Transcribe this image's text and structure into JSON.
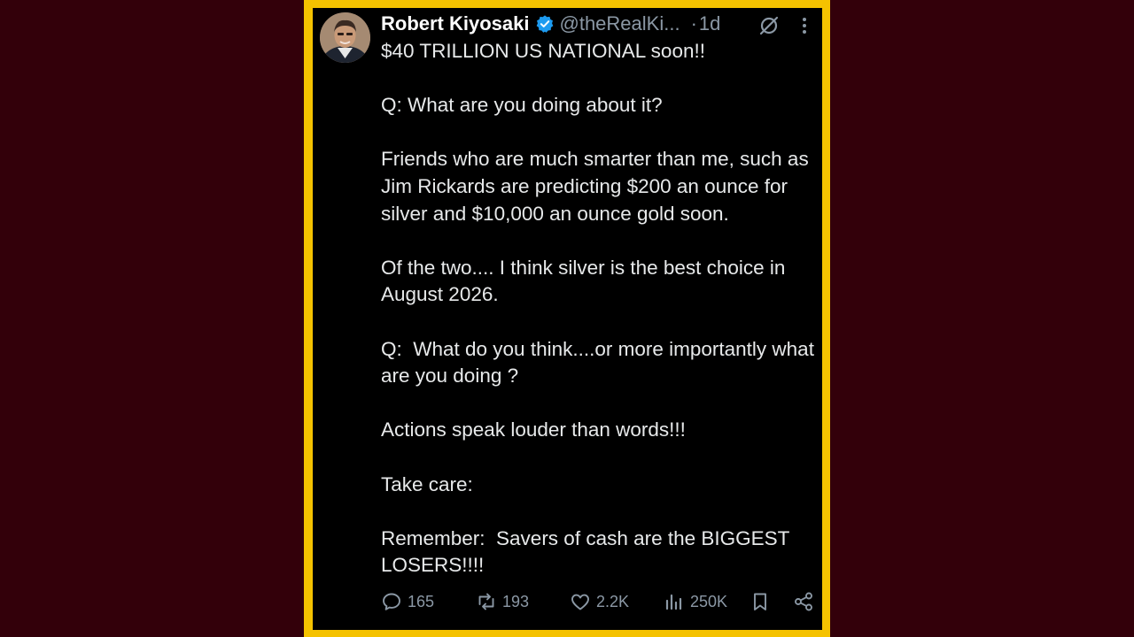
{
  "tweet": {
    "author_name": "Robert Kiyosaki",
    "handle": "@theRealKi...",
    "separator": "·",
    "time": "1d",
    "paragraphs": [
      "$40 TRILLION US NATIONAL soon!!",
      "Q: What are you doing about it?",
      "Friends who are much smarter than me, such as Jim Rickards are predicting $200 an ounce for silver and $10,000 an ounce gold soon.",
      "Of the two.... I think silver is the best choice in August 2026.",
      "Q:  What do you think....or more importantly what are you doing ?",
      "Actions speak louder than words!!!",
      "Take care:",
      "Remember:  Savers of cash are the BIGGEST LOSERS!!!!"
    ]
  },
  "actions": {
    "replies": "165",
    "reposts": "193",
    "likes": "2.2K",
    "views": "250K"
  },
  "icons": {
    "verified": "verified-badge-icon",
    "grok": "grok-icon",
    "more": "more-options-icon",
    "reply": "reply-icon",
    "repost": "repost-icon",
    "like": "heart-icon",
    "views": "views-icon",
    "bookmark": "bookmark-icon",
    "share": "share-icon"
  },
  "colors": {
    "background": "#33000a",
    "frame": "#f5c200",
    "card": "#000000",
    "text": "#e7e9ea",
    "muted": "#8b98a5",
    "verified": "#1d9bf0"
  }
}
